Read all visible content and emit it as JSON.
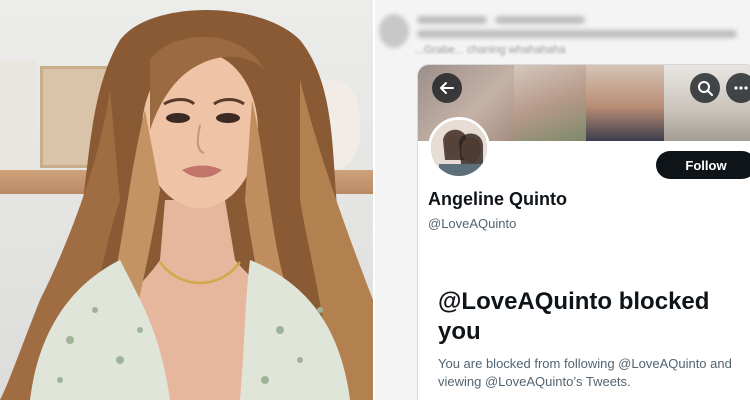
{
  "feed_preview": {
    "blurred_caption": "...Grabe... chaning whahahaha"
  },
  "profile": {
    "display_name": "Angeline Quinto",
    "handle": "@LoveAQuinto",
    "follow_label": "Follow"
  },
  "blocked_notice": {
    "title": "@LoveAQuinto blocked you",
    "description": "You are blocked from following @LoveAQuinto and viewing @LoveAQuinto’s Tweets."
  },
  "icons": {
    "back": "arrow-left-icon",
    "search": "search-icon",
    "more": "more-dots-icon"
  },
  "colors": {
    "follow_button_bg": "#0f1419",
    "primary_text": "#0f1419",
    "secondary_text": "#536471"
  }
}
